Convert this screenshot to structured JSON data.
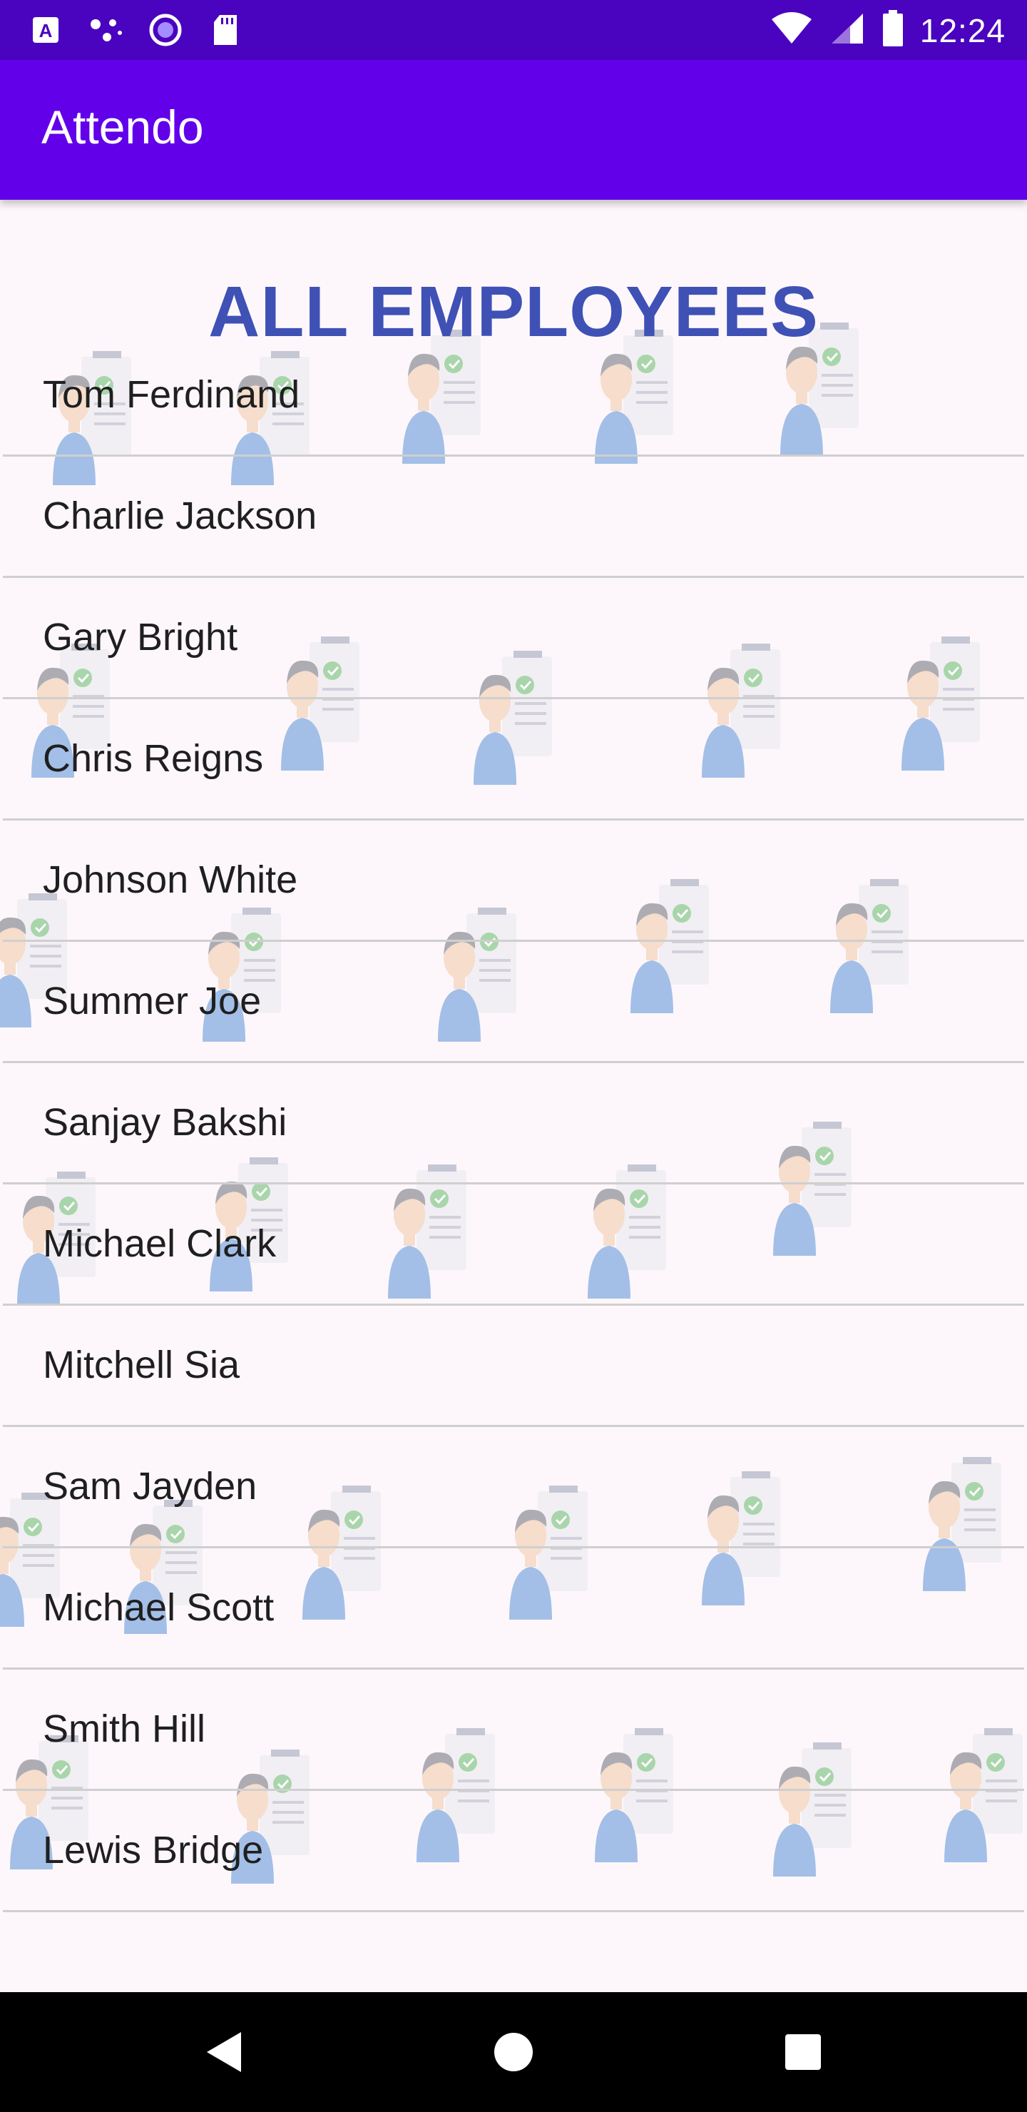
{
  "status_bar": {
    "time": "12:24",
    "icons": [
      "text-a-icon",
      "dots-icon",
      "record-circle-icon",
      "sd-card-icon",
      "wifi-icon",
      "signal-icon",
      "battery-icon"
    ]
  },
  "app_bar": {
    "title": "Attendo"
  },
  "main": {
    "heading": "ALL EMPLOYEES",
    "employees": [
      "Tom Ferdinand",
      "Charlie Jackson",
      "Gary Bright",
      "Chris Reigns",
      "Johnson White",
      "Summer Joe",
      "Sanjay Bakshi",
      "Michael Clark",
      "Mitchell Sia",
      "Sam Jayden",
      "Michael Scott",
      "Smith Hill",
      "Lewis Bridge"
    ]
  },
  "nav_bar": {
    "buttons": [
      "back-icon",
      "home-icon",
      "recents-icon"
    ]
  },
  "colors": {
    "status_bar": "#4a03bf",
    "app_bar": "#6200ea",
    "heading": "#3f51b5",
    "background": "#fdf7fb"
  }
}
